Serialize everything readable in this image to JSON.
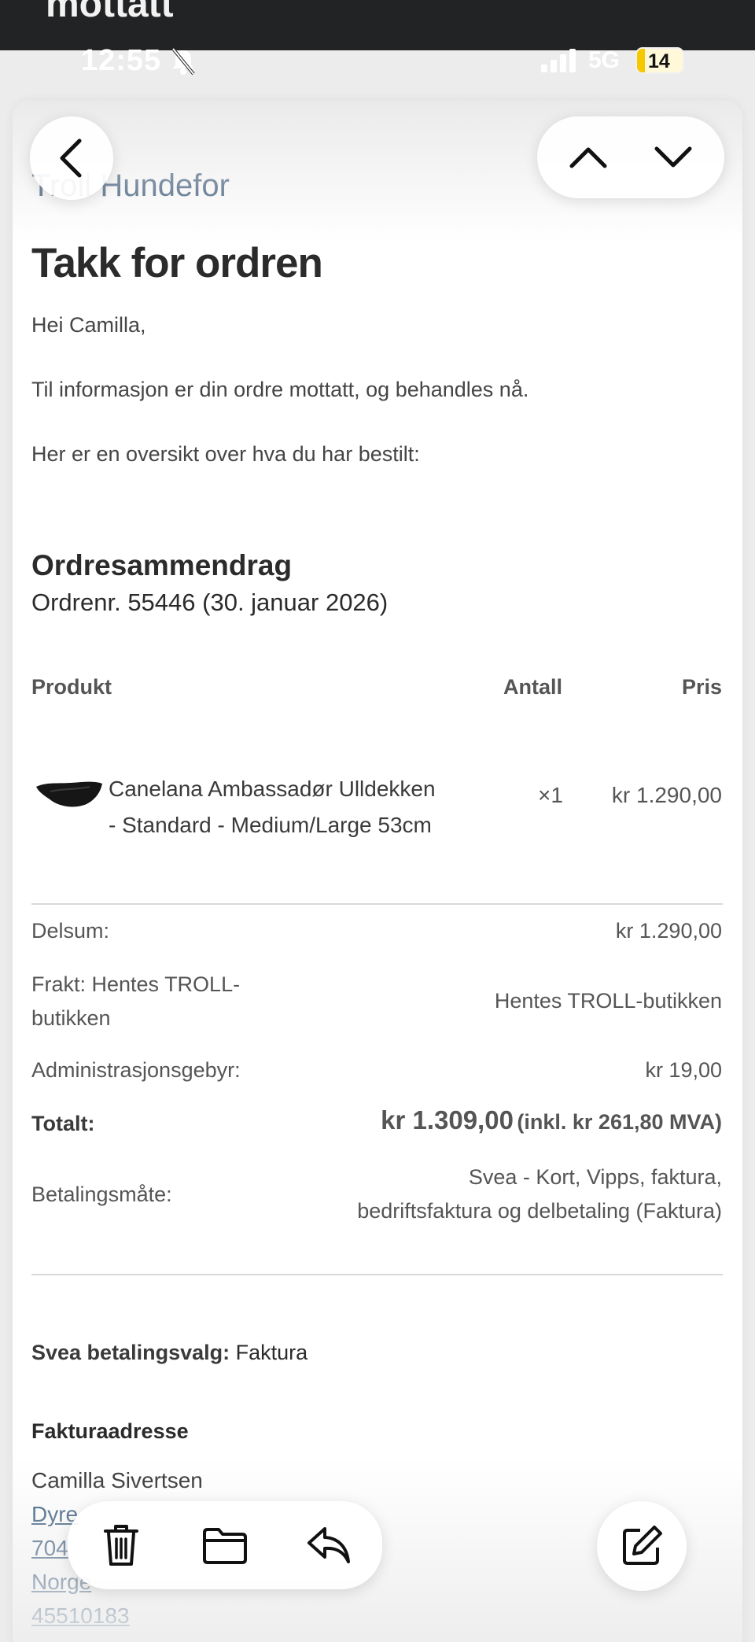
{
  "window": {
    "title": "mottatt"
  },
  "status_bar": {
    "time": "12:55",
    "network": "5G",
    "battery": "14",
    "battery_level_percent": 14
  },
  "email": {
    "store_name": "Troll Hundefor",
    "heading": "Takk for ordren",
    "greeting": "Hei Camilla,",
    "info": "Til informasjon er din ordre mottatt, og behandles nå.",
    "overview": "Her er en oversikt over hva du har bestilt:",
    "summary_title": "Ordresammendrag",
    "order_number": "Ordrenr. 55446 (30. januar 2026)",
    "table_headers": {
      "product": "Produkt",
      "quantity": "Antall",
      "price": "Pris"
    },
    "items": [
      {
        "name_line1": "Canelana Ambassadør Ulldekken",
        "name_line2": "- Standard - Medium/Large 53cm",
        "quantity": "×1",
        "price": "kr 1.290,00"
      }
    ],
    "totals": {
      "subtotal_label": "Delsum:",
      "subtotal_value": "kr 1.290,00",
      "shipping_label_line1": "Frakt: Hentes TROLL-",
      "shipping_label_line2": "butikken",
      "shipping_value": "Hentes TROLL-butikken",
      "admin_label": "Administrasjonsgebyr:",
      "admin_value": "kr 19,00",
      "total_label": "Totalt:",
      "total_value": "kr 1.309,00",
      "total_vat": "(inkl. kr 261,80 MVA)",
      "payment_label": "Betalingsmåte:",
      "payment_value_line1": "Svea - Kort, Vipps, faktura,",
      "payment_value_line2": "bedriftsfaktura og delbetaling (Faktura)"
    },
    "svea_label": "Svea betalingsvalg:",
    "svea_value": "Faktura",
    "billing_title": "Fakturaadresse",
    "billing": {
      "name": "Camilla Sivertsen",
      "street": "Dyre",
      "zip": "704",
      "country": "Norge",
      "phone": "45510183"
    }
  },
  "toolbar": {
    "back_icon": "chevron-left-icon",
    "up_icon": "chevron-up-icon",
    "down_icon": "chevron-down-icon",
    "delete_icon": "trash-icon",
    "move_icon": "folder-icon",
    "reply_icon": "reply-icon",
    "compose_icon": "compose-icon"
  }
}
